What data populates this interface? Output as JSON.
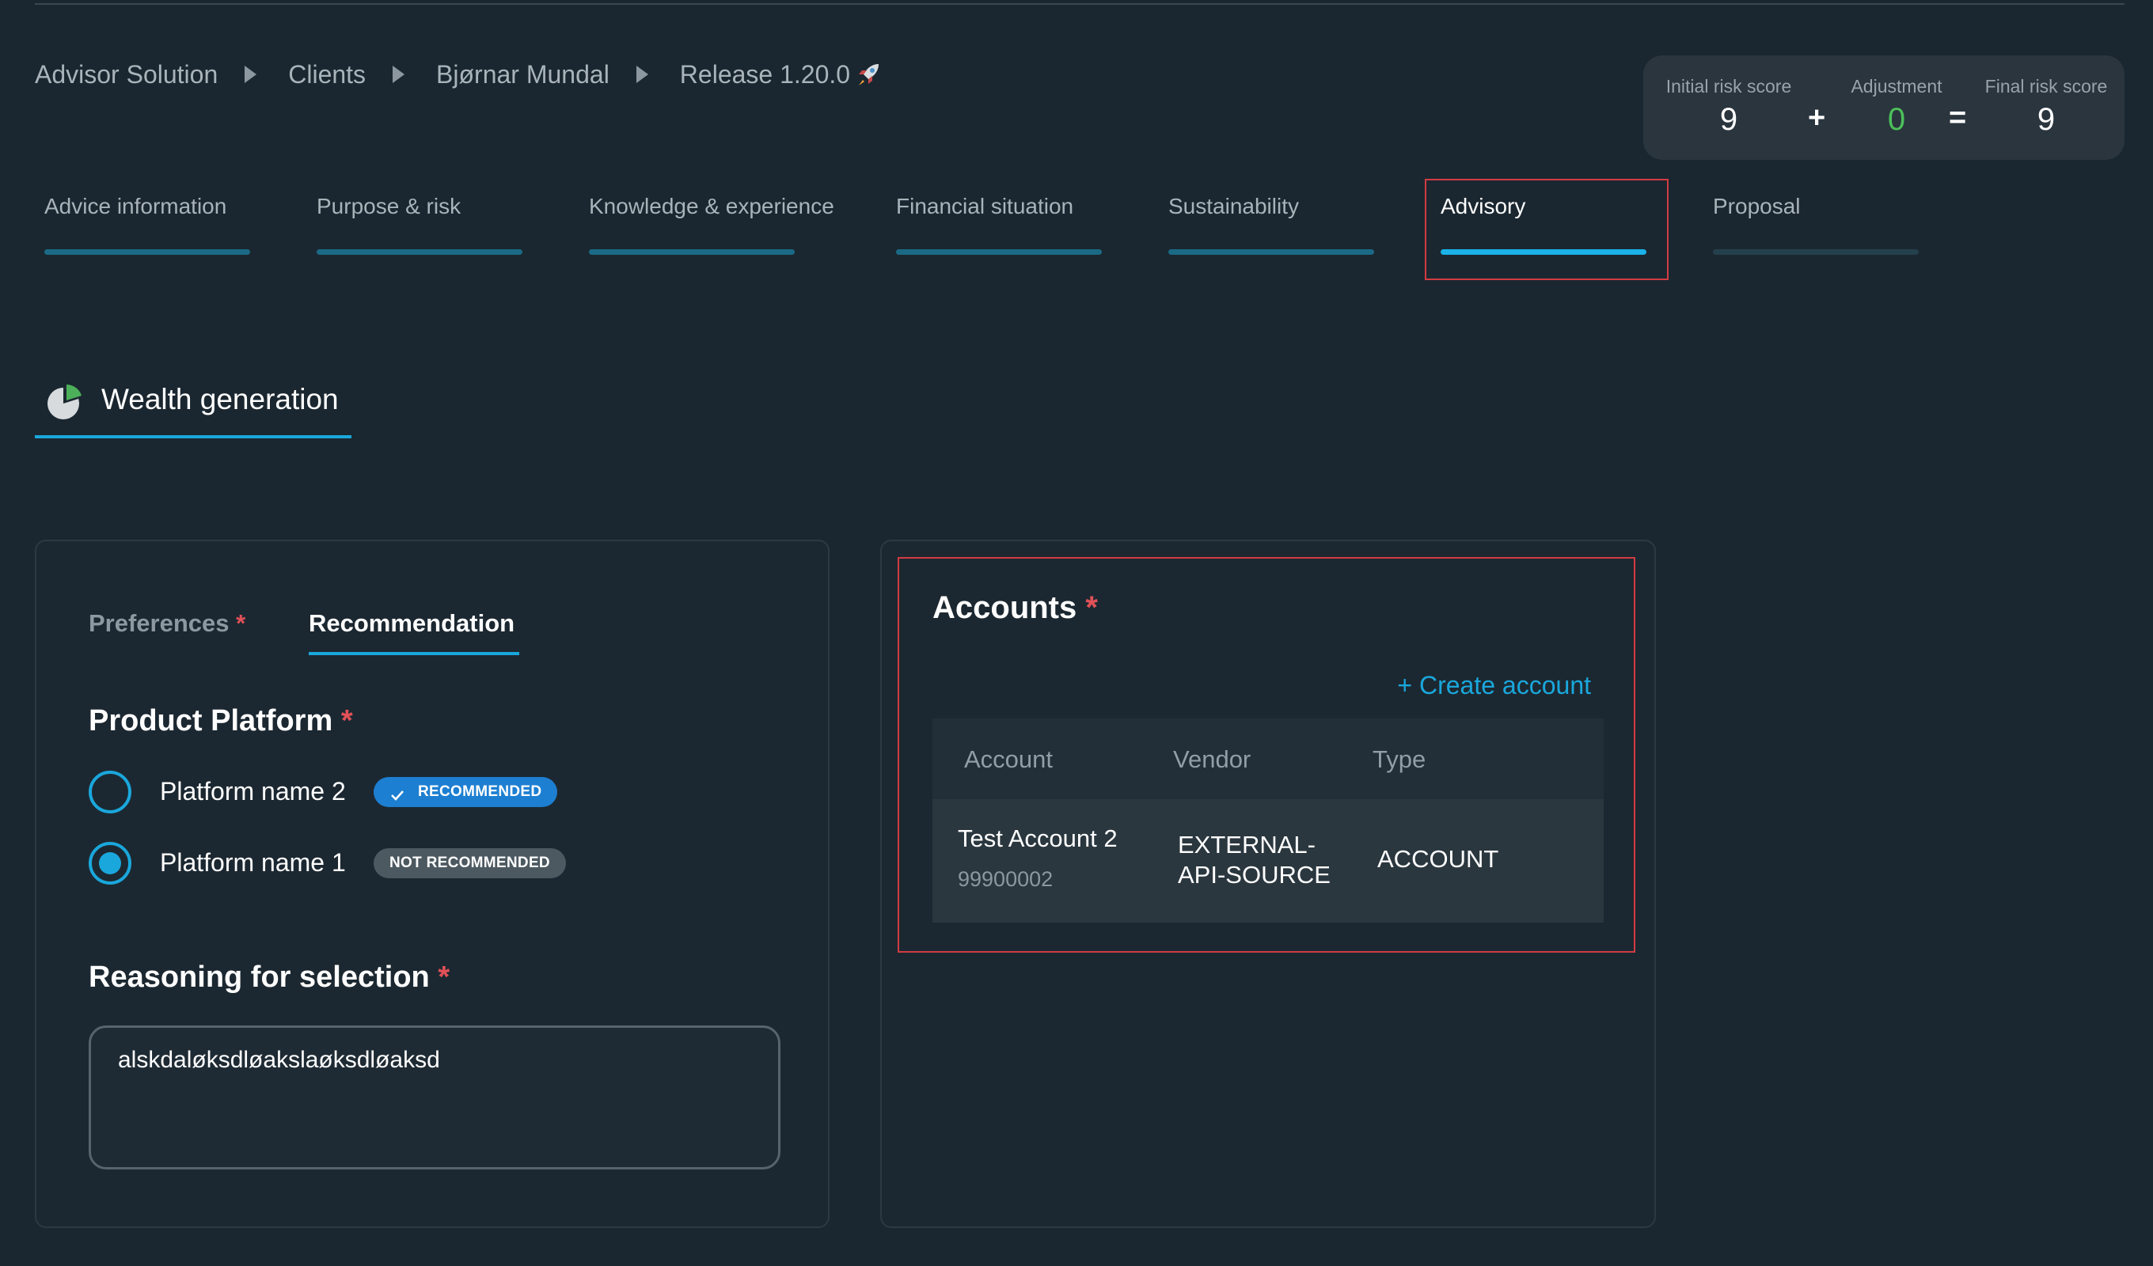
{
  "breadcrumb": [
    "Advisor Solution",
    "Clients",
    "Bjørnar Mundal",
    "Release 1.20.0"
  ],
  "risk": {
    "initial_label": "Initial risk score",
    "initial_value": "9",
    "plus": "+",
    "adjustment_label": "Adjustment",
    "adjustment_value": "0",
    "equals": "=",
    "final_label": "Final risk score",
    "final_value": "9"
  },
  "tabs": [
    {
      "label": "Advice information"
    },
    {
      "label": "Purpose & risk"
    },
    {
      "label": "Knowledge & experience"
    },
    {
      "label": "Financial situation"
    },
    {
      "label": "Sustainability"
    },
    {
      "label": "Advisory"
    },
    {
      "label": "Proposal"
    }
  ],
  "section": {
    "title": "Wealth generation"
  },
  "subtabs": {
    "preferences": "Preferences",
    "recommendation": "Recommendation",
    "required_mark": "*"
  },
  "product_platform": {
    "title": "Product Platform",
    "options": [
      {
        "label": "Platform name 2",
        "badge": "RECOMMENDED",
        "selected": false
      },
      {
        "label": "Platform name 1",
        "badge": "NOT RECOMMENDED",
        "selected": true
      }
    ]
  },
  "reasoning": {
    "title": "Reasoning for selection",
    "value": "alskdaløksdløakslaøksdløaksd"
  },
  "accounts": {
    "title": "Accounts",
    "create_label": "+ Create account",
    "columns": [
      "Account",
      "Vendor",
      "Type"
    ],
    "rows": [
      {
        "name": "Test Account 2",
        "number": "99900002",
        "vendor_line1": "EXTERNAL-",
        "vendor_line2": "API-SOURCE",
        "type": "ACCOUNT"
      }
    ]
  },
  "colors": {
    "accent": "#1aa7dc",
    "required": "#e25158",
    "highlight": "#d23b42",
    "positive": "#4cc05a",
    "background": "#1b2730"
  }
}
